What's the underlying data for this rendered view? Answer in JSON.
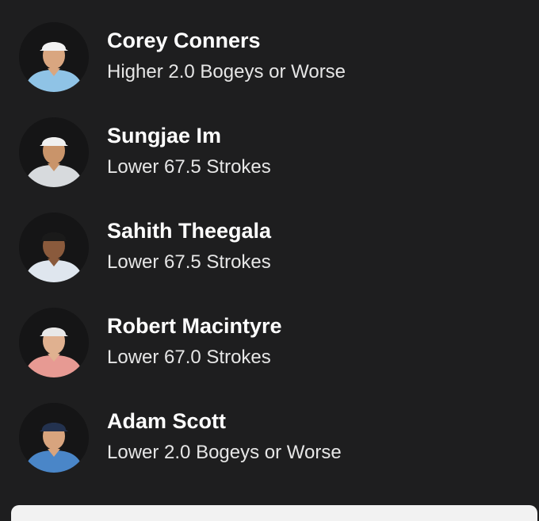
{
  "picks": [
    {
      "name": "Corey Conners",
      "pick": "Higher 2.0 Bogeys or Worse",
      "shirt": "#8fc3e6",
      "cap": "#f2f2f2",
      "skin": "#d9a680",
      "icon": "player-photo-icon"
    },
    {
      "name": "Sungjae Im",
      "pick": "Lower 67.5 Strokes",
      "shirt": "#d7dadd",
      "cap": "#f0f0f0",
      "skin": "#c9946a",
      "icon": "player-photo-icon"
    },
    {
      "name": "Sahith Theegala",
      "pick": "Lower 67.5 Strokes",
      "shirt": "#dfe6ee",
      "cap": "#1a1a1a",
      "skin": "#8a5a3c",
      "icon": "player-photo-icon"
    },
    {
      "name": "Robert Macintyre",
      "pick": "Lower 67.0 Strokes",
      "shirt": "#e79a93",
      "cap": "#e8e8e8",
      "skin": "#e0b190",
      "icon": "player-photo-icon"
    },
    {
      "name": "Adam Scott",
      "pick": "Lower 2.0 Bogeys or Worse",
      "shirt": "#4a86c8",
      "cap": "#23324f",
      "skin": "#d8a47e",
      "icon": "player-photo-icon"
    }
  ]
}
